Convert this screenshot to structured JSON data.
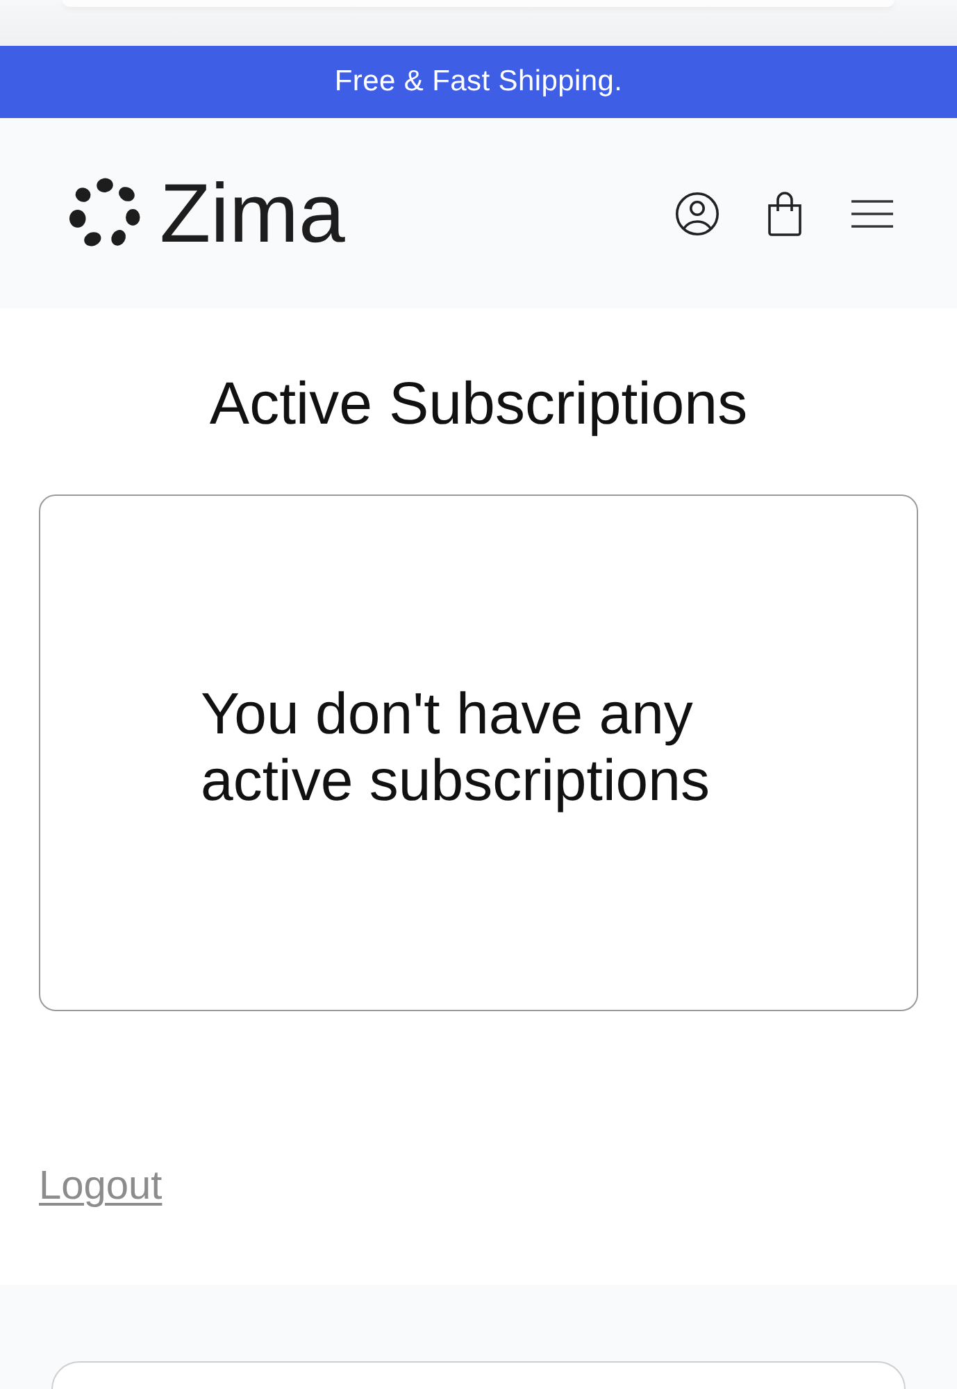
{
  "announcement": {
    "text": "Free & Fast Shipping."
  },
  "header": {
    "logo": {
      "text": "Zima"
    }
  },
  "main": {
    "title": "Active Subscriptions",
    "empty_message": "You don't have any active subscriptions",
    "logout": {
      "label": "Logout"
    }
  }
}
